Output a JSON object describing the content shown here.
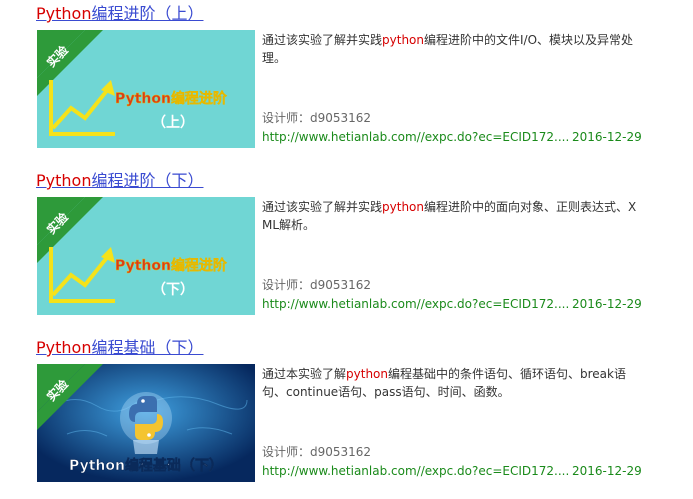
{
  "results": [
    {
      "title_kw": "Python",
      "title_rest": "编程进阶（上）",
      "thumb": {
        "badge": "实验",
        "title_kw": "Python",
        "title_rest": "编程进阶",
        "sub": "（上）",
        "bg": "#70d6d4"
      },
      "desc_pre": "通过该实验了解并实践",
      "desc_kw": "python",
      "desc_post": "编程进阶中的文件I/O、模块以及异常处理。",
      "designer": "设计师：d9053162",
      "url": "http://www.hetianlab.com//expc.do?ec=ECID172....",
      "date": "2016-12-29"
    },
    {
      "title_kw": "Python",
      "title_rest": "编程进阶（下）",
      "thumb": {
        "badge": "实验",
        "title_kw": "Python",
        "title_rest": "编程进阶",
        "sub": "（下）",
        "bg": "#70d6d4"
      },
      "desc_pre": "通过该实验了解并实践",
      "desc_kw": "python",
      "desc_post": "编程进阶中的面向对象、正则表达式、XML解析。",
      "designer": "设计师：d9053162",
      "url": "http://www.hetianlab.com//expc.do?ec=ECID172....",
      "date": "2016-12-29"
    },
    {
      "title_kw": "Python",
      "title_rest": "编程基础（下）",
      "thumb": {
        "badge": "实验",
        "caption": "Python编程基础（下）",
        "bg": "#0a3a7a"
      },
      "desc_pre": "通过本实验了解",
      "desc_kw": "python",
      "desc_post": "编程基础中的条件语句、循环语句、break语句、continue语句、pass语句、时间、函数。",
      "designer": "设计师：d9053162",
      "url": "http://www.hetianlab.com//expc.do?ec=ECID172....",
      "date": "2016-12-29"
    }
  ],
  "colors": {
    "link": "#3a4bd1",
    "keyword": "#d60000",
    "url": "#1a8a1a",
    "badge": "#2e9a3a",
    "chart_yellow": "#f5e21a"
  }
}
